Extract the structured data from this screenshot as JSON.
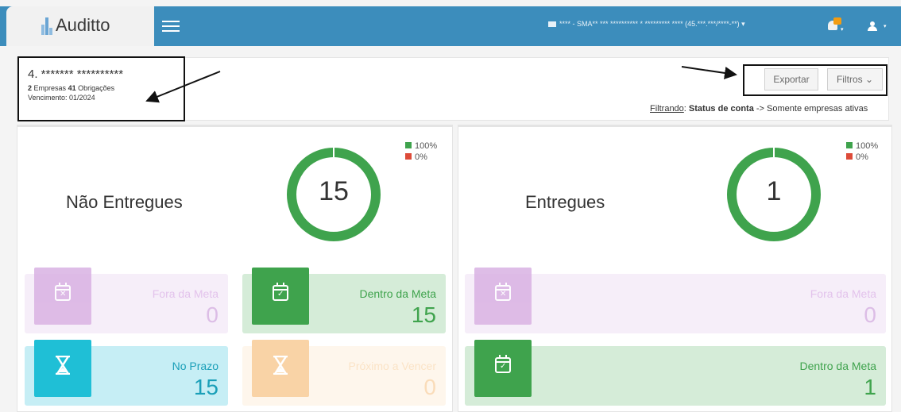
{
  "app": {
    "name": "Auditto"
  },
  "topbar": {
    "company_selector": "**** - SMA** *** ********** * ********* **** (45.***.***/****-**)",
    "caret": "▾"
  },
  "summary": {
    "title": "4. ******* **********",
    "companies_count": "2",
    "companies_label": "Empresas",
    "obligations_count": "41",
    "obligations_label": "Obrigações",
    "due_label": "Vencimento:",
    "due_value": "01/2024"
  },
  "actions": {
    "export_label": "Exportar",
    "filters_label": "Filtros ⌄"
  },
  "filter": {
    "prefix": "Filtrando",
    "field": "Status de conta",
    "arrow": "->",
    "value": "Somente empresas ativas"
  },
  "colors": {
    "topbar": "#3c8dbc",
    "green": "#3fa34d",
    "red": "#dd4b39",
    "purple": "#d4a9e0",
    "cyan": "#1fbfd6",
    "orange": "#f9c27f"
  },
  "not_delivered": {
    "title": "Não Entregues",
    "total": "15",
    "legend": [
      {
        "label": "100%",
        "color": "#3fa34d"
      },
      {
        "label": "0%",
        "color": "#dd4b39"
      }
    ],
    "donut_fraction": 1.0,
    "stats": [
      {
        "label": "Fora da Meta",
        "value": "0",
        "icon": "calendar-x-icon"
      },
      {
        "label": "Dentro da Meta",
        "value": "15",
        "icon": "calendar-check-icon"
      },
      {
        "label": "No Prazo",
        "value": "15",
        "icon": "hourglass-icon"
      },
      {
        "label": "Próximo a Vencer",
        "value": "0",
        "icon": "hourglass-icon"
      }
    ]
  },
  "delivered": {
    "title": "Entregues",
    "total": "1",
    "legend": [
      {
        "label": "100%",
        "color": "#3fa34d"
      },
      {
        "label": "0%",
        "color": "#dd4b39"
      }
    ],
    "donut_fraction": 1.0,
    "stats": [
      {
        "label": "Fora da Meta",
        "value": "0",
        "icon": "calendar-x-icon"
      },
      {
        "label": "Dentro da Meta",
        "value": "1",
        "icon": "calendar-check-icon"
      }
    ]
  }
}
